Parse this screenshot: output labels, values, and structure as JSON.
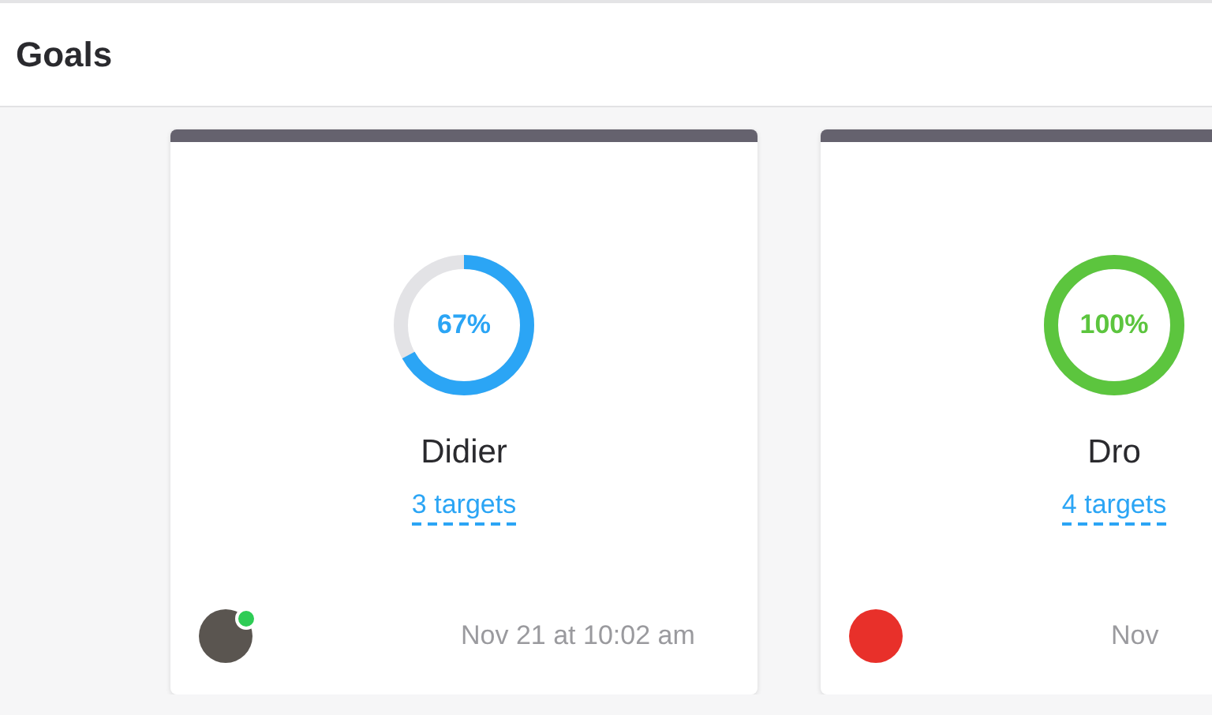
{
  "header": {
    "title": "Goals"
  },
  "goals": [
    {
      "percent": "67%",
      "level": 0.67,
      "color": "#2ba5f5",
      "name": "Didier",
      "targets": "3 targets",
      "owner": {
        "online": true,
        "color": "#5a5550"
      },
      "updated": "Nov 21 at 10:02 am"
    },
    {
      "percent": "100%",
      "level": 1,
      "color": "#5cc53e",
      "name": "Dro",
      "targets": "4 targets",
      "owner": {
        "online": false,
        "color": "#e8302a"
      },
      "updated": "Nov"
    }
  ]
}
